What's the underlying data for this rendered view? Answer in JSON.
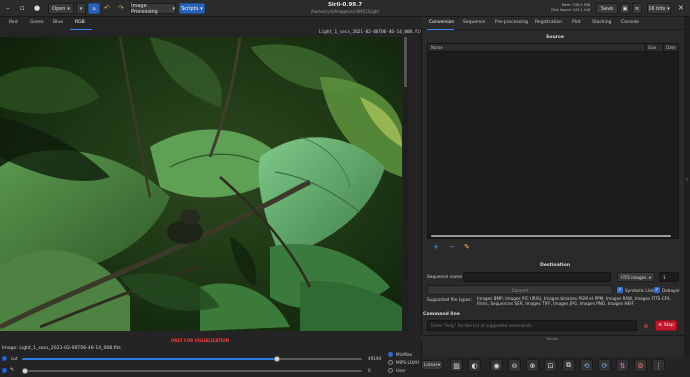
{
  "header": {
    "title": "Siril-0.99.7",
    "subtitle": "/home/cyril/Images/siril/M51/Light",
    "open_label": "Open",
    "processing_label": "Image Processing",
    "scripts_label": "Scripts",
    "save_label": "Save",
    "bits_label": "16 bits",
    "mem_line": "Mem: 536.5  MiB",
    "disk_line": "Disk Space: 100.1  GiB"
  },
  "viewer_tabs": [
    "Red",
    "Green",
    "Blue",
    "RGB"
  ],
  "image": {
    "filename_overlay": "Light_1_secs_2021-02-06T06-46-14_008.fits",
    "only_visualization": "ONLY FOR VISUALIZATION",
    "info": "Image: Light_1_secs_2021-02-06T06-46-14_008.fits"
  },
  "display_controls": {
    "cut_label": "cut",
    "high_value": "49194",
    "low_value": "0",
    "modes": [
      "MinMax",
      "MIPS-LO/HI",
      "User"
    ],
    "selected_mode": "MinMax",
    "scale_label": "Linear",
    "high_slider_fraction": 0.75,
    "low_slider_fraction": 0.0
  },
  "right_tabs": [
    "Conversion",
    "Sequence",
    "Pre-processing",
    "Registration",
    "Plot",
    "Stacking",
    "Console"
  ],
  "source": {
    "title": "Source",
    "columns": [
      "Name",
      "Size",
      "Date"
    ]
  },
  "destination": {
    "title": "Destination",
    "seq_name_label": "Sequence name:",
    "format_value": "FITS images",
    "start_index": "1",
    "convert_label": "Convert",
    "symbolic_link_label": "Symbolic Link",
    "debayer_label": "Debayer",
    "supported_label": "Supported file types:",
    "supported_text": "Images BMP, Images PIC (IRIS), Images binaires PGM et PPM, Images RAW, Images FITS-CFA, Films, Sequences SER, Images TIFF, Images JPG, Images PNG, Images HEIF"
  },
  "command": {
    "title": "Command line",
    "placeholder": "Enter \"help\" for the list of supported commands",
    "stop_label": "Stop",
    "status": "Ready"
  }
}
